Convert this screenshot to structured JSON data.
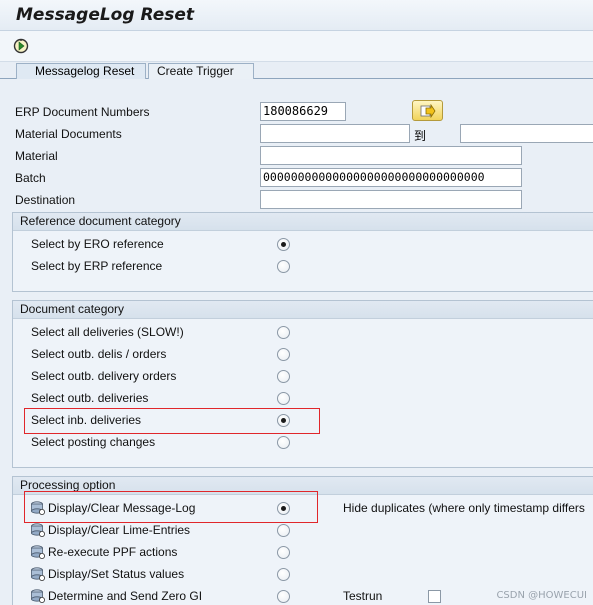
{
  "window": {
    "title": "MessageLog Reset"
  },
  "toolbar": {
    "execute_icon": "execute-icon"
  },
  "tabs": [
    {
      "label": "Messagelog Reset",
      "active": true
    },
    {
      "label": "Create Trigger",
      "active": false
    }
  ],
  "fields": {
    "erp_doc_numbers": {
      "label": "ERP Document Numbers",
      "value": "180086629"
    },
    "material_docs": {
      "label": "Material Documents",
      "value": "",
      "to_label": "到",
      "to_value": ""
    },
    "material": {
      "label": "Material",
      "value": ""
    },
    "batch": {
      "label": "Batch",
      "value": "00000000000000000000000000000000"
    },
    "destination": {
      "label": "Destination",
      "value": ""
    }
  },
  "ref_doc_category": {
    "title": "Reference document category",
    "options": [
      {
        "label": "Select by ERO reference",
        "selected": true
      },
      {
        "label": "Select by ERP reference",
        "selected": false
      }
    ]
  },
  "doc_category": {
    "title": "Document category",
    "options": [
      {
        "label": "Select all deliveries (SLOW!)",
        "selected": false
      },
      {
        "label": "Select outb. delis / orders",
        "selected": false
      },
      {
        "label": "Select outb. delivery orders",
        "selected": false
      },
      {
        "label": "Select outb. deliveries",
        "selected": false
      },
      {
        "label": "Select inb. deliveries",
        "selected": true
      },
      {
        "label": "Select posting changes",
        "selected": false
      }
    ]
  },
  "processing_option": {
    "title": "Processing option",
    "options": [
      {
        "label": "Display/Clear Message-Log",
        "selected": true
      },
      {
        "label": "Display/Clear Lime-Entries",
        "selected": false
      },
      {
        "label": "Re-execute PPF actions",
        "selected": false
      },
      {
        "label": "Display/Set Status values",
        "selected": false
      },
      {
        "label": "Determine and Send Zero GI",
        "selected": false
      }
    ],
    "hide_duplicates_label": "Hide duplicates (where only timestamp differs",
    "testrun_label": "Testrun",
    "testrun_checked": false
  },
  "watermark": "CSDN @HOWECUI",
  "colors": {
    "highlight": "#e0262b",
    "background": "#e9eff6",
    "group_header": "#d6e1ec"
  }
}
